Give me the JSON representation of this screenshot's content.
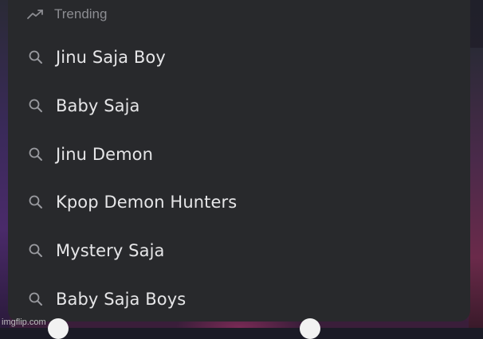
{
  "dropdown": {
    "section_icon": "trending-up-icon",
    "section_title": "Trending",
    "item_icon": "search-icon",
    "items": [
      {
        "label": "Jinu Saja Boy"
      },
      {
        "label": "Baby Saja"
      },
      {
        "label": "Jinu Demon"
      },
      {
        "label": "Kpop Demon Hunters"
      },
      {
        "label": "Mystery Saja"
      },
      {
        "label": "Baby Saja Boys"
      }
    ]
  },
  "watermark": "imgflip.com",
  "colors": {
    "panel": "#28292c",
    "text": "#e6e6e8",
    "muted": "#8c8d92"
  }
}
